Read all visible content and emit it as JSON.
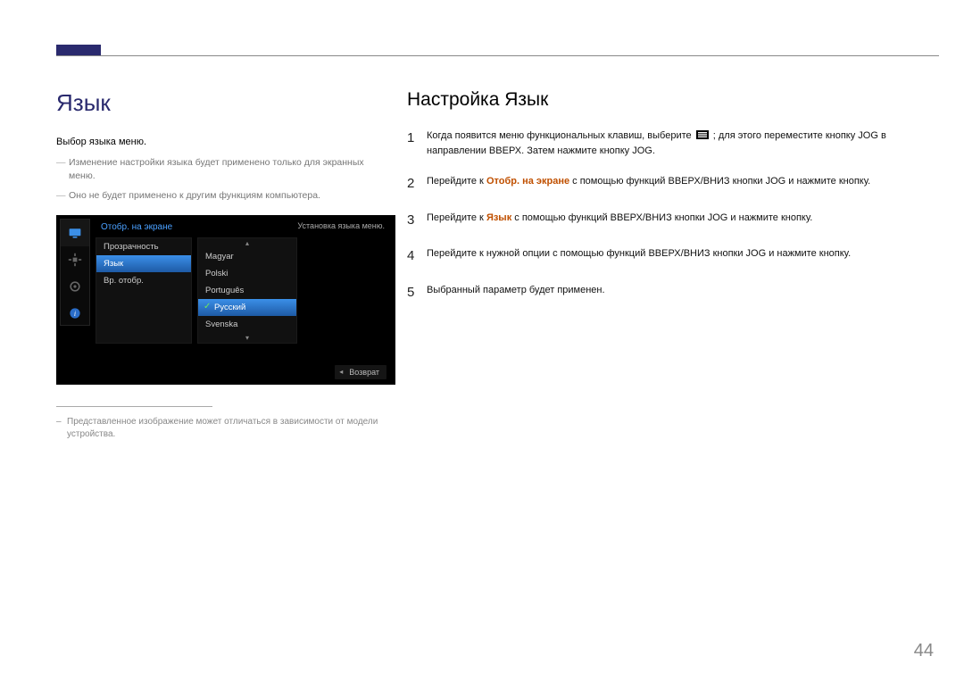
{
  "page_number": "44",
  "left": {
    "title": "Язык",
    "desc_main": "Выбор языка меню.",
    "desc_sub1": "Изменение настройки языка будет применено только для экранных меню.",
    "desc_sub2": "Оно не будет применено к другим функциям компьютера.",
    "footnote": "Представленное изображение может отличаться в зависимости от модели устройства."
  },
  "osd": {
    "panel_title": "Отобр. на экране",
    "hint": "Установка языка меню.",
    "menu_items": [
      "Прозрачность",
      "Язык",
      "Вр. отобр."
    ],
    "menu_selected_index": 1,
    "lang_items": [
      "Magyar",
      "Polski",
      "Português",
      "Русский",
      "Svenska"
    ],
    "lang_selected_index": 3,
    "footer": "Возврат"
  },
  "right": {
    "title": "Настройка Язык",
    "steps": [
      {
        "num": "1",
        "text_before": "Когда появится меню функциональных клавиш, выберите ",
        "icon": true,
        "text_after": " ; для этого переместите кнопку JOG в направлении ВВЕРХ. Затем нажмите кнопку JOG."
      },
      {
        "num": "2",
        "text_before": "Перейдите к ",
        "accent": "Отобр. на экране",
        "text_after": " с помощью функций ВВЕРХ/ВНИЗ кнопки JOG и нажмите кнопку."
      },
      {
        "num": "3",
        "text_before": "Перейдите к ",
        "accent": "Язык",
        "text_after": " с помощью функций ВВЕРХ/ВНИЗ кнопки JOG и нажмите кнопку."
      },
      {
        "num": "4",
        "text_before": "Перейдите к нужной опции с помощью функций ВВЕРХ/ВНИЗ кнопки JOG и нажмите кнопку."
      },
      {
        "num": "5",
        "text_before": "Выбранный параметр будет применен."
      }
    ]
  }
}
